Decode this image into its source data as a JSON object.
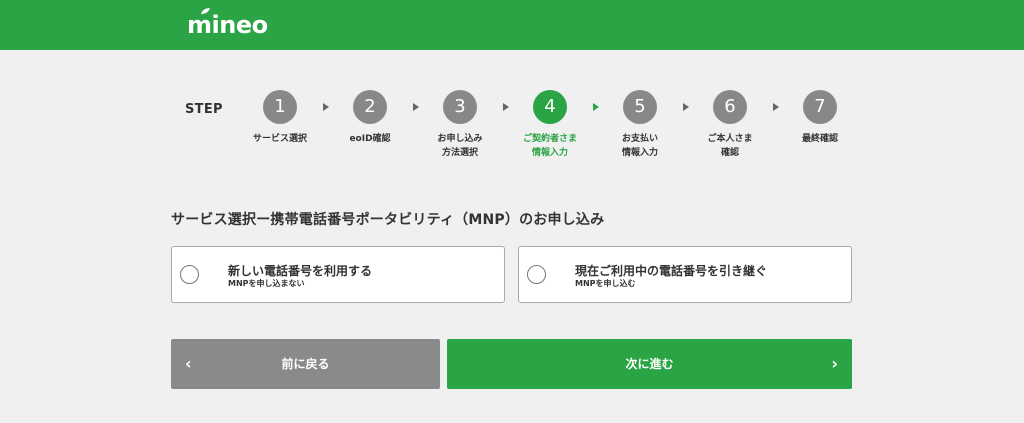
{
  "header": {
    "logo_text": "mineo",
    "brand_color": "#2aa444"
  },
  "stepper": {
    "label": "STEP",
    "steps": [
      {
        "number": "1",
        "label": "サービス選択",
        "active": false
      },
      {
        "number": "2",
        "label": "eoID確認",
        "active": false
      },
      {
        "number": "3",
        "label": "お申し込み\n方法選択",
        "active": false
      },
      {
        "number": "4",
        "label": "ご契約者さま\n情報入力",
        "active": true
      },
      {
        "number": "5",
        "label": "お支払い\n情報入力",
        "active": false
      },
      {
        "number": "6",
        "label": "ご本人さま\n確認",
        "active": false
      },
      {
        "number": "7",
        "label": "最終確認",
        "active": false
      }
    ]
  },
  "main": {
    "title": "サービス選択ー携帯電話番号ポータビリティ（MNP）のお申し込み",
    "options": [
      {
        "title": "新しい電話番号を利用する",
        "subtitle": "MNPを申し込まない",
        "selected": false
      },
      {
        "title": "現在ご利用中の電話番号を引き継ぐ",
        "subtitle": "MNPを申し込む",
        "selected": false
      }
    ]
  },
  "footer": {
    "back_label": "前に戻る",
    "next_label": "次に進む",
    "back_icon": "chevron-left-icon",
    "next_icon": "chevron-right-icon"
  }
}
